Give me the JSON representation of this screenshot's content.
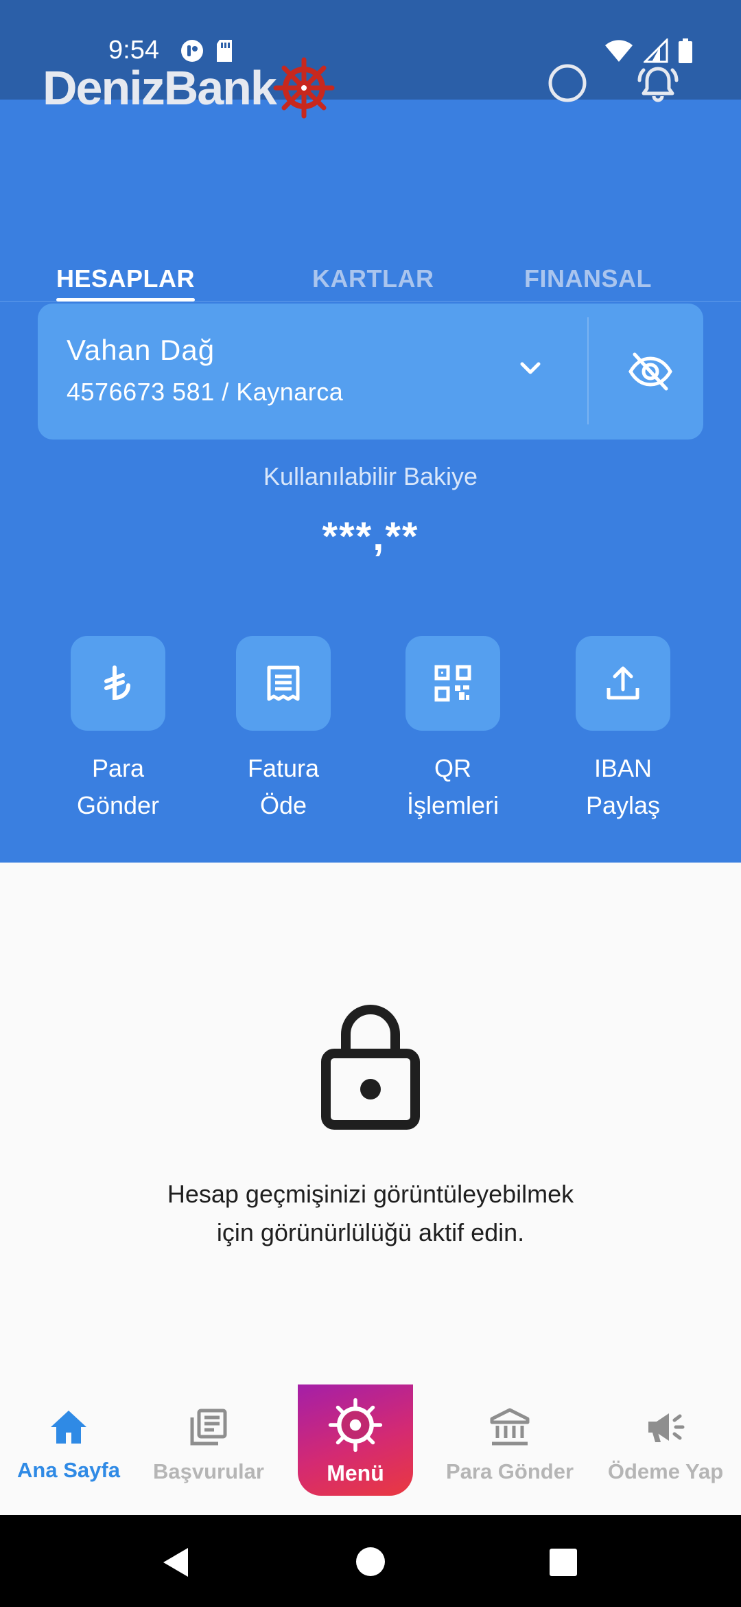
{
  "status_bar": {
    "time": "9:54"
  },
  "header": {
    "logo_text": "DenizBank",
    "tabs": [
      {
        "label": "HESAPLAR",
        "active": true
      },
      {
        "label": "KARTLAR",
        "active": false
      },
      {
        "label": "FINANSAL",
        "active": false
      }
    ]
  },
  "account": {
    "name": "Vahan Dağ",
    "number_branch": "4576673 581 / Kaynarca",
    "balance_label": "Kullanılabilir Bakiye",
    "balance_value": "***,**"
  },
  "actions": [
    {
      "label": "Para\nGönder",
      "icon": "lira-icon"
    },
    {
      "label": "Fatura\nÖde",
      "icon": "receipt-icon"
    },
    {
      "label": "QR\nİşlemleri",
      "icon": "qr-code-icon"
    },
    {
      "label": "IBAN\nPaylaş",
      "icon": "share-upload-icon"
    }
  ],
  "locked_history": {
    "message": "Hesap geçmişinizi görüntüleyebilmek\niçin görünürlülüğü aktif edin."
  },
  "bottom_nav": {
    "home": "Ana Sayfa",
    "applications": "Başvurular",
    "menu": "Menü",
    "send_money": "Para Gönder",
    "payments": "Ödeme Yap"
  },
  "colors": {
    "primary_blue": "#3a7fe0",
    "status_bar_blue": "#2b5fa8",
    "card_blue": "#559fef",
    "active_nav": "#2f8ae5",
    "logo_red": "#c8281e"
  }
}
